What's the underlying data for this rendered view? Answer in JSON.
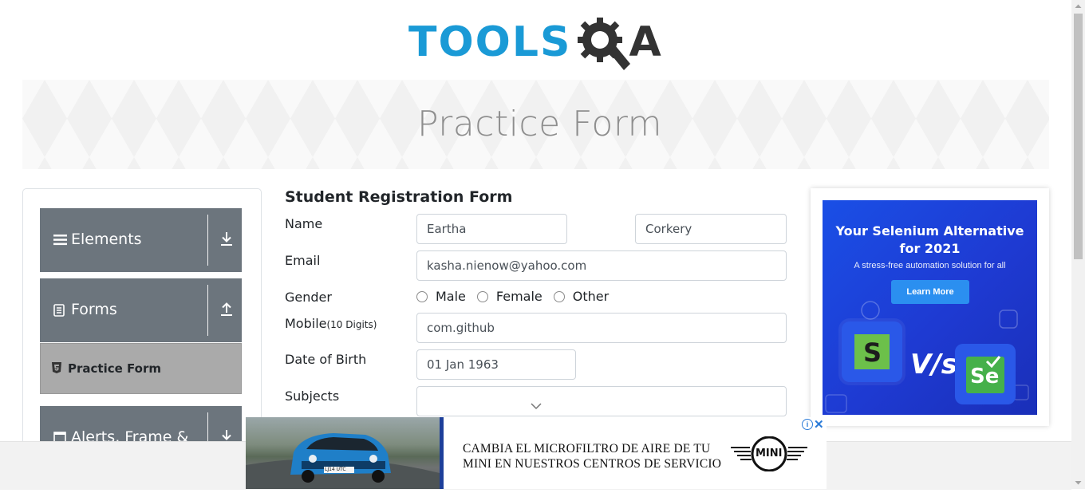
{
  "logo": {
    "text_prefix": "TOOLS",
    "text_suffix": "A"
  },
  "banner": {
    "title": "Practice Form"
  },
  "sidebar": {
    "groups": [
      {
        "label": "Elements",
        "icon": "hamburger-icon",
        "arrow": "download-arrow-icon"
      },
      {
        "label": "Forms",
        "icon": "document-icon",
        "arrow": "upload-arrow-icon"
      },
      {
        "label": "Alerts, Frame &",
        "icon": "window-icon",
        "arrow": "download-arrow-icon"
      }
    ],
    "active_item": {
      "label": "Practice Form",
      "icon": "html5-icon"
    }
  },
  "form": {
    "title": "Student Registration Form",
    "name_label": "Name",
    "first_name": "Eartha",
    "last_name": "Corkery",
    "email_label": "Email",
    "email": "kasha.nienow@yahoo.com",
    "gender_label": "Gender",
    "gender_options": [
      "Male",
      "Female",
      "Other"
    ],
    "mobile_label": "Mobile",
    "mobile_hint": "(10 Digits)",
    "mobile": "com.github",
    "dob_label": "Date of Birth",
    "dob": "01 Jan 1963",
    "subjects_label": "Subjects",
    "subjects_value": ""
  },
  "right_ad": {
    "headline_line1": "Your Selenium Alternative",
    "headline_line2": "for 2021",
    "subtitle": "A stress-free automation solution for all",
    "button": "Learn More",
    "vs": "V/s",
    "left_logo_letter": "S",
    "right_logo_letters": "Se",
    "colors": {
      "background": "#1e3ad2",
      "accent_green": "#6cc04a"
    }
  },
  "bottom_ad": {
    "line1": "CAMBIA EL MICROFILTRO DE AIRE DE TU",
    "line2": "MINI EN NUESTROS CENTROS DE SERVICIO",
    "brand": "MINI",
    "plate": "LJ14 UTC",
    "info_symbol": "i",
    "close_symbol": "✕"
  },
  "colors": {
    "logo_blue": "#1a9ad6",
    "logo_gray": "#333333",
    "sidebar_header": "#6c757d",
    "active_item": "#aaaaaa"
  }
}
